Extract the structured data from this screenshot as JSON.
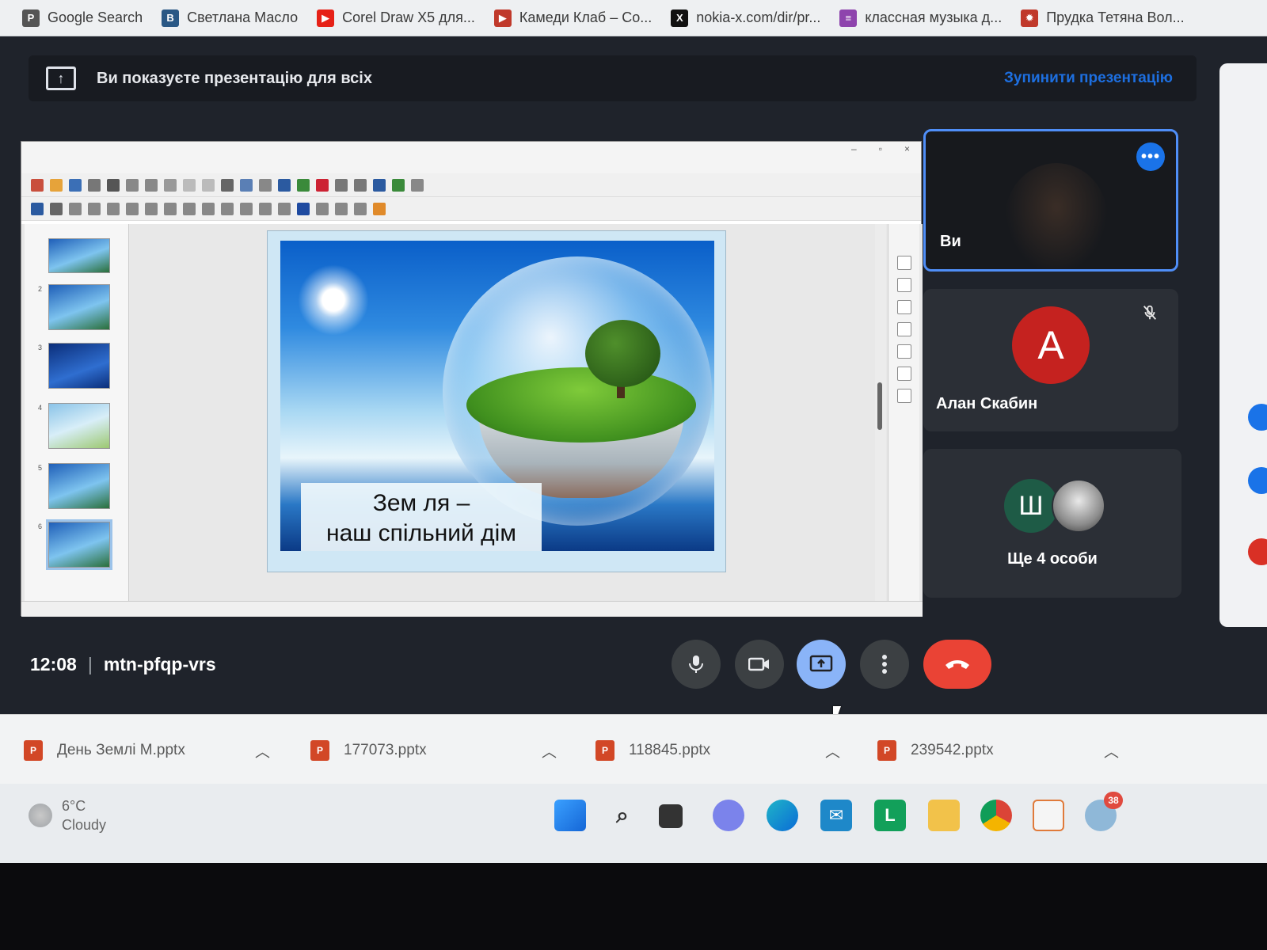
{
  "bookmarks": [
    {
      "label": "Google Search",
      "icon": "bookmark-p-icon",
      "color": "#555555"
    },
    {
      "label": "Светлана Масло",
      "icon": "vk-icon",
      "color": "#2a5885"
    },
    {
      "label": "Corel Draw X5 для...",
      "icon": "youtube-icon",
      "color": "#e62117"
    },
    {
      "label": "Камеди Клаб – Со...",
      "icon": "video-icon",
      "color": "#c0392b"
    },
    {
      "label": "nokia-x.com/dir/pr...",
      "icon": "x-icon",
      "color": "#111111"
    },
    {
      "label": "классная музыка д...",
      "icon": "chart-icon",
      "color": "#8e44ad"
    },
    {
      "label": "Прудка Тетяна Вол...",
      "icon": "sun-icon",
      "color": "#c0392b"
    }
  ],
  "banner": {
    "text": "Ви показуєте презентацію для всіх",
    "stop_label": "Зупинити презентацію"
  },
  "slide": {
    "caption_line1": "Зем ля –",
    "caption_line2": "наш спільний дім"
  },
  "participants": {
    "you": {
      "name": "Ви"
    },
    "alan": {
      "initial": "А",
      "name": "Алан Скабин"
    },
    "more": {
      "initial": "Ш",
      "label": "Ще 4 особи"
    }
  },
  "meeting": {
    "time": "12:08",
    "separator": "|",
    "code": "mtn-pfqp-vrs"
  },
  "downloads": [
    {
      "name": "День Землі М.pptx"
    },
    {
      "name": "177073.pptx"
    },
    {
      "name": "118845.pptx"
    },
    {
      "name": "239542.pptx"
    }
  ],
  "weather": {
    "temp": "6°C",
    "condition": "Cloudy"
  },
  "taskbar": {
    "notification_badge": "38"
  },
  "colors": {
    "accent": "#1a73e8",
    "hangup": "#ea4335",
    "present_active": "#8ab4f8",
    "meet_bg": "#1f232b"
  }
}
